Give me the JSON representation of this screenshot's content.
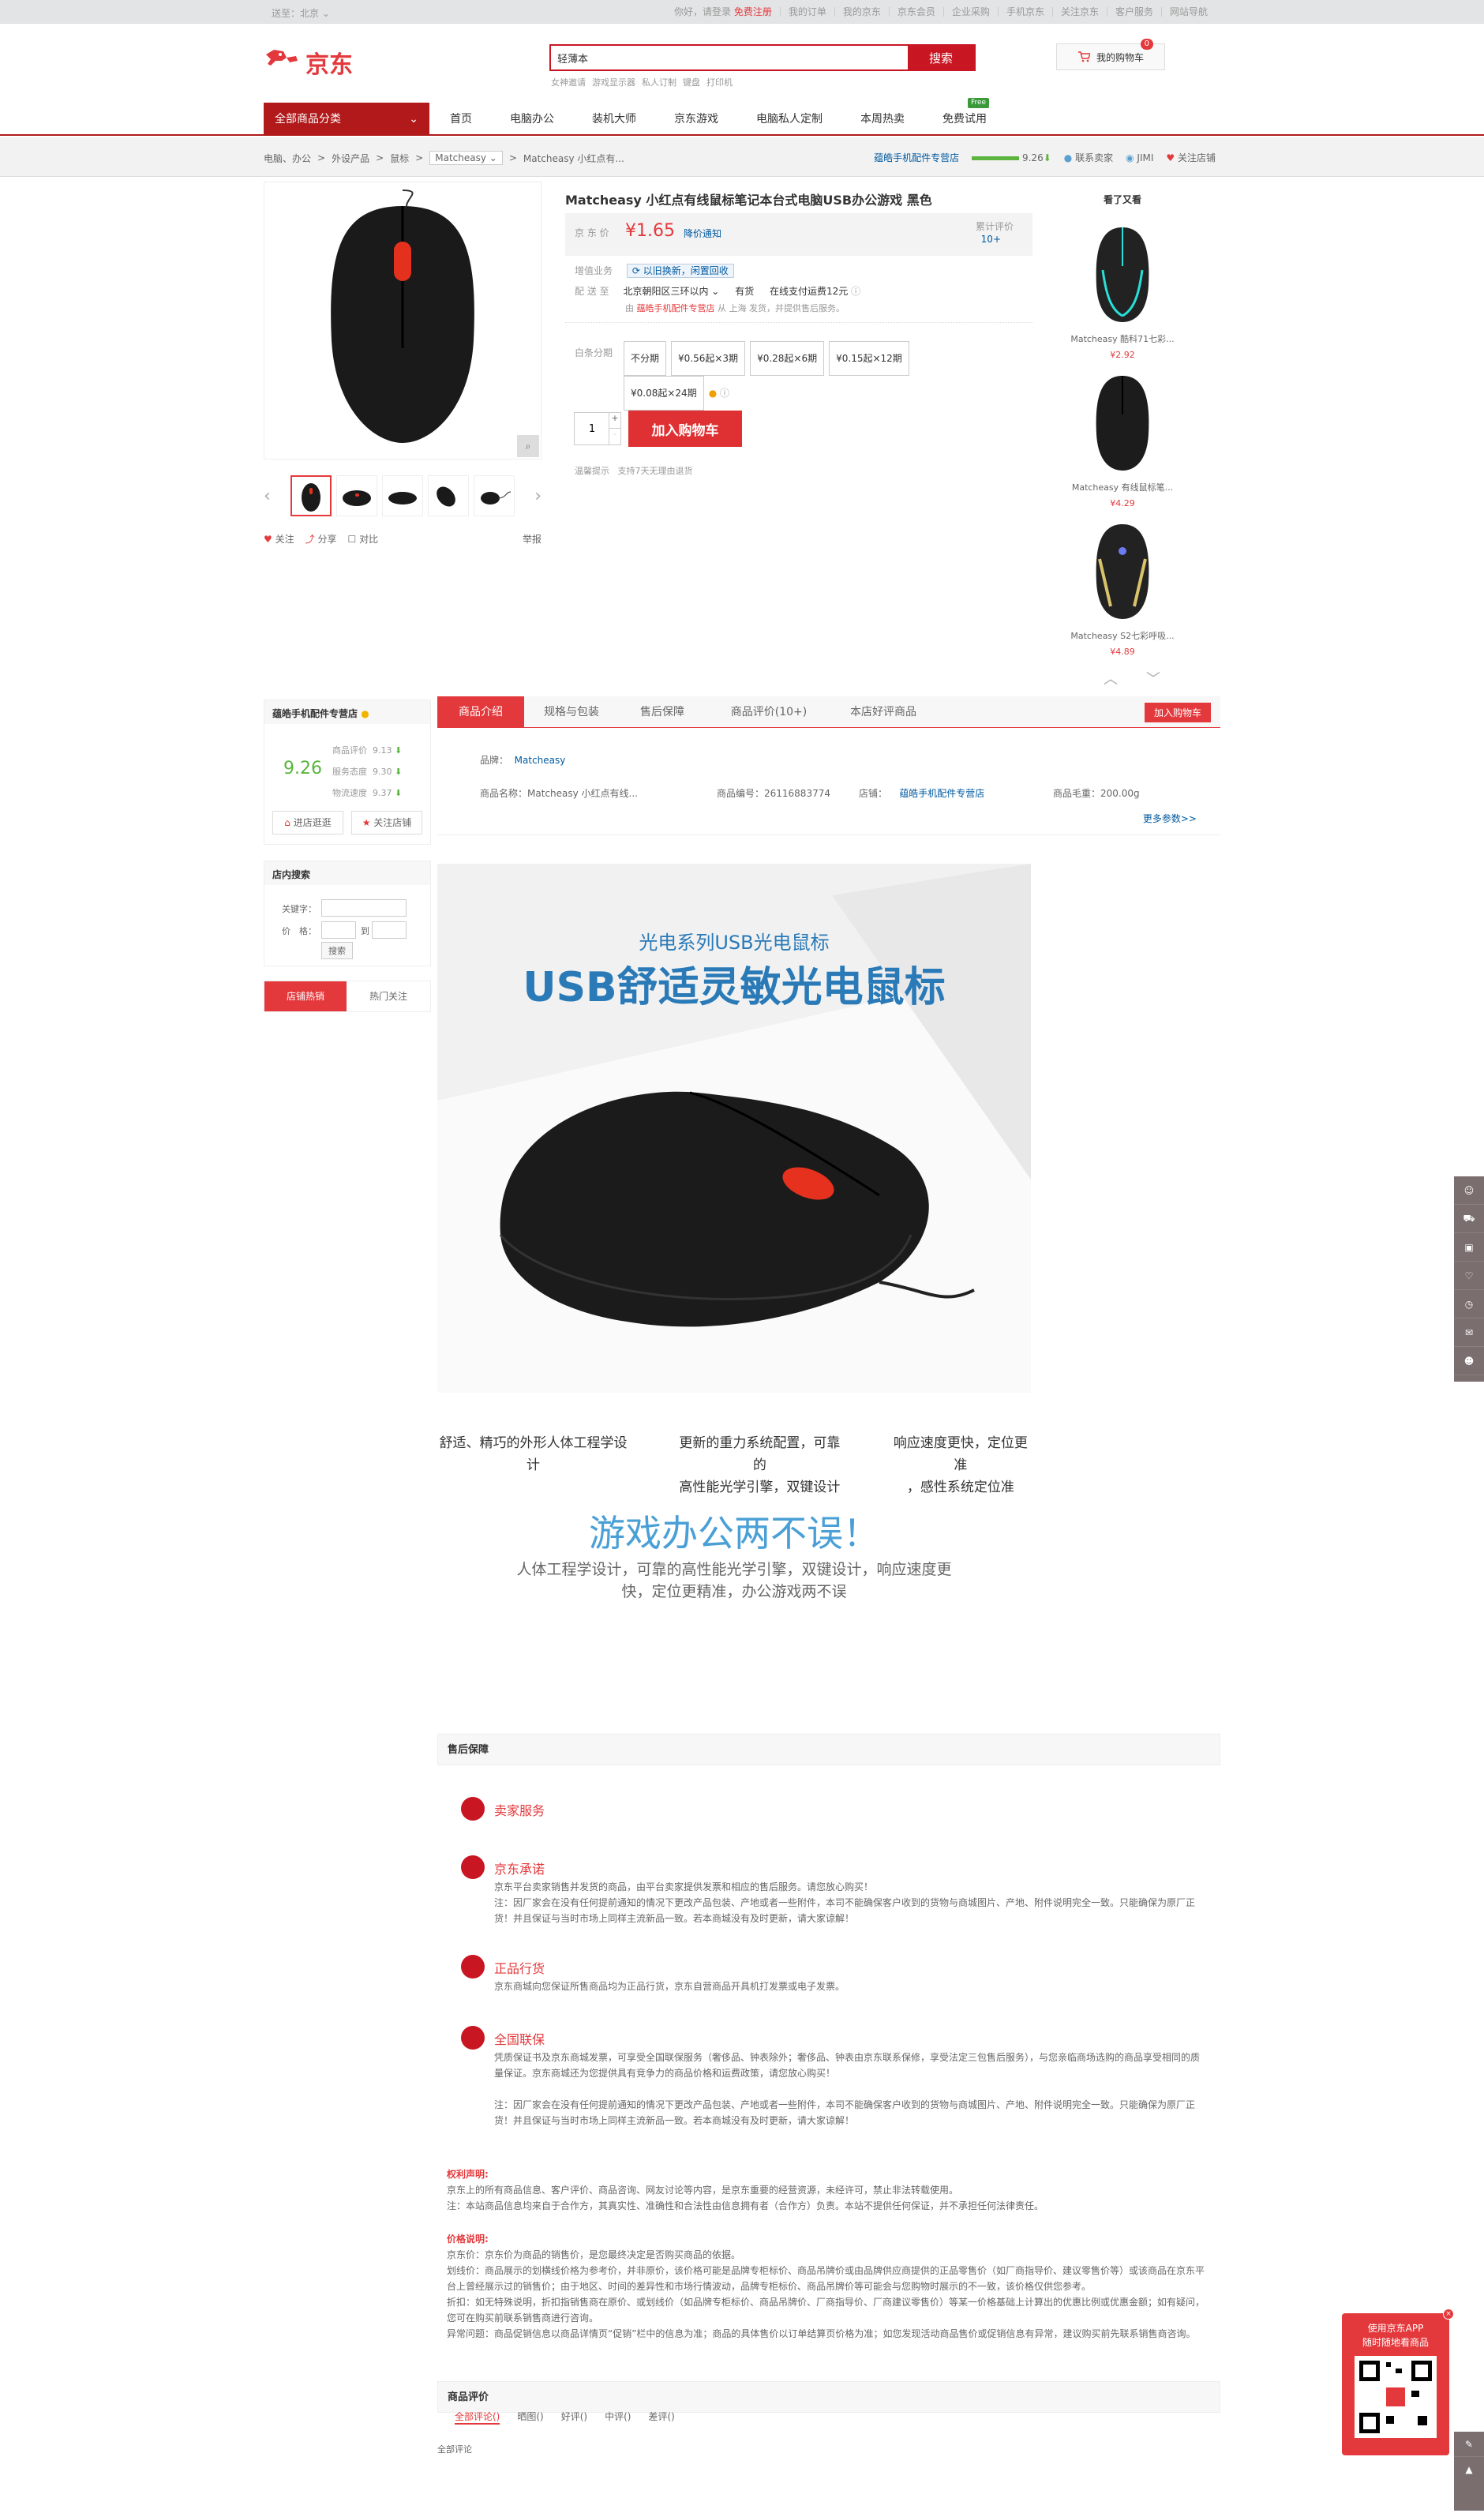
{
  "shortcut": {
    "location": "送至：北京",
    "location_arrow": "⌄",
    "login_hello": "你好，请登录",
    "register": "免费注册",
    "links": [
      "我的订单",
      "我的京东",
      "京东会员",
      "企业采购",
      "手机京东",
      "关注京东",
      "客户服务",
      "网站导航"
    ]
  },
  "header": {
    "logo_text": "京东",
    "search_value": "轻薄本",
    "search_button": "搜索",
    "hotwords": [
      "女神邀请",
      "游戏显示器",
      "私人订制",
      "键盘",
      "打印机"
    ],
    "cart_label": "我的购物车",
    "cart_count": "0"
  },
  "nav": {
    "all_categories": "全部商品分类",
    "items": [
      "首页",
      "电脑办公",
      "装机大师",
      "京东游戏",
      "电脑私人定制",
      "本周热卖",
      "免费试用"
    ],
    "new_badge": "Free"
  },
  "crumb": {
    "items": [
      "电脑、办公",
      "外设产品",
      "鼠标"
    ],
    "brand": "Matcheasy",
    "product": "Matcheasy 小红点有...",
    "shop_name": "蕴皓手机配件专营店",
    "shop_score": "9.26",
    "contact": "联系卖家",
    "jimi": "JIMI",
    "follow": "关注店铺"
  },
  "product": {
    "name": "Matcheasy 小红点有线鼠标笔记本台式电脑USB办公游戏 黑色",
    "price_label": "京 东 价",
    "price": "¥1.65",
    "price_notice": "降价通知",
    "review_label": "累计评价",
    "review_count": "10+",
    "promo_label": "增值业务",
    "promo_value": "以旧换新，闲置回收",
    "ship_label": "配 送 至",
    "ship_region": "北京朝阳区三环以内",
    "stock": "有货",
    "ship_note": "在线支付运费12元",
    "seller_line_prefix": "由",
    "seller_shop": "蕴皓手机配件专营店",
    "seller_line_suffix": "从 上海 发货，并提供售后服务。",
    "installment_label": "白条分期",
    "installments": [
      "不分期",
      "¥0.56起×3期",
      "¥0.28起×6期",
      "¥0.15起×12期",
      "¥0.08起×24期"
    ],
    "quantity": "1",
    "add_to_cart": "加入购物车",
    "tips_label": "温馨提示",
    "tips": "支持7天无理由退货",
    "actions": [
      "关注",
      "分享",
      "对比"
    ],
    "report": "举报"
  },
  "also_viewed": {
    "title": "看了又看",
    "items": [
      {
        "name": "Matcheasy 酷科71七彩...",
        "price": "¥2.92"
      },
      {
        "name": "Matcheasy 有线鼠标笔...",
        "price": "¥4.29"
      },
      {
        "name": "Matcheasy S2七彩呼吸...",
        "price": "¥4.89"
      }
    ]
  },
  "shop": {
    "name": "蕴皓手机配件专营店",
    "score": "9.26",
    "metrics": [
      {
        "label": "商品评价",
        "value": "9.13"
      },
      {
        "label": "服务态度",
        "value": "9.30"
      },
      {
        "label": "物流速度",
        "value": "9.37"
      }
    ],
    "enter": "进店逛逛",
    "follow": "关注店铺",
    "search_title": "店内搜索",
    "keyword_label": "关键字：",
    "price_label": "价　格：",
    "price_to": "到",
    "search_btn": "搜索",
    "tabs": [
      "店铺热销",
      "热门关注"
    ]
  },
  "tabs": {
    "items": [
      "商品介绍",
      "规格与包装",
      "售后保障",
      "商品评价(10+)",
      "本店好评商品"
    ],
    "add_to_cart": "加入购物车"
  },
  "params": {
    "brand_label": "品牌：",
    "brand": "Matcheasy",
    "name": "商品名称：Matcheasy 小红点有线...",
    "sku": "商品编号：26116883774",
    "shop_label": "店铺：",
    "shop": "蕴皓手机配件专营店",
    "weight": "商品毛重：200.00g",
    "more": "更多参数>>"
  },
  "detail": {
    "subtitle": "光电系列USB光电鼠标",
    "title": "USB舒适灵敏光电鼠标",
    "features": [
      "舒适、精巧的外形人体工程学设计",
      "更新的重力系统配置，可靠的\n高性能光学引擎，双键设计",
      "响应速度更快，定位更准\n，感性系统定位准"
    ],
    "slogan": "游戏办公两不误！",
    "slogan_sub": "人体工程学设计，可靠的高性能光学引擎，双键设计，响应速度更快，定位更精准，办公游戏两不误"
  },
  "aftersale": {
    "title": "售后保障",
    "services": [
      {
        "title": "卖家服务",
        "desc": ""
      },
      {
        "title": "京东承诺",
        "desc": "京东平台卖家销售并发货的商品，由平台卖家提供发票和相应的售后服务。请您放心购买！\n注：因厂家会在没有任何提前通知的情况下更改产品包装、产地或者一些附件，本司不能确保客户收到的货物与商城图片、产地、附件说明完全一致。只能确保为原厂正货！并且保证与当时市场上同样主流新品一致。若本商城没有及时更新，请大家谅解！"
      },
      {
        "title": "正品行货",
        "desc": "京东商城向您保证所售商品均为正品行货，京东自营商品开具机打发票或电子发票。"
      },
      {
        "title": "全国联保",
        "desc": "凭质保证书及京东商城发票，可享受全国联保服务（奢侈品、钟表除外；奢侈品、钟表由京东联系保修，享受法定三包售后服务），与您亲临商场选购的商品享受相同的质量保证。京东商城还为您提供具有竞争力的商品价格和运费政策，请您放心购买！\n\n注：因厂家会在没有任何提前通知的情况下更改产品包装、产地或者一些附件，本司不能确保客户收到的货物与商城图片、产地、附件说明完全一致。只能确保为原厂正货！并且保证与当时市场上同样主流新品一致。若本商城没有及时更新，请大家谅解！"
      }
    ]
  },
  "notices": {
    "rights_title": "权利声明:",
    "rights_text": "京东上的所有商品信息、客户评价、商品咨询、网友讨论等内容，是京东重要的经营资源，未经许可，禁止非法转载使用。\n注：本站商品信息均来自于合作方，其真实性、准确性和合法性由信息拥有者（合作方）负责。本站不提供任何保证，并不承担任何法律责任。",
    "price_title": "价格说明:",
    "price_text": "京东价：京东价为商品的销售价，是您最终决定是否购买商品的依据。\n划线价：商品展示的划横线价格为参考价，并非原价，该价格可能是品牌专柜标价、商品吊牌价或由品牌供应商提供的正品零售价（如厂商指导价、建议零售价等）或该商品在京东平台上曾经展示过的销售价；由于地区、时间的差异性和市场行情波动，品牌专柜标价、商品吊牌价等可能会与您购物时展示的不一致，该价格仅供您参考。\n折扣：如无特殊说明，折扣指销售商在原价、或划线价（如品牌专柜标价、商品吊牌价、厂商指导价、厂商建议零售价）等某一价格基础上计算出的优惠比例或优惠金额；如有疑问，您可在购买前联系销售商进行咨询。\n异常问题：商品促销信息以商品详情页“促销”栏中的信息为准；商品的具体售价以订单结算页价格为准；如您发现活动商品售价或促销信息有异常，建议购买前先联系销售商咨询。"
  },
  "reviews": {
    "title": "商品评价",
    "tabs": [
      "全部评论()",
      "晒图()",
      "好评()",
      "中评()",
      "差评()"
    ],
    "all_label": "全部评论"
  },
  "app_promo": {
    "line1": "使用京东APP",
    "line2": "随时随地看商品"
  }
}
